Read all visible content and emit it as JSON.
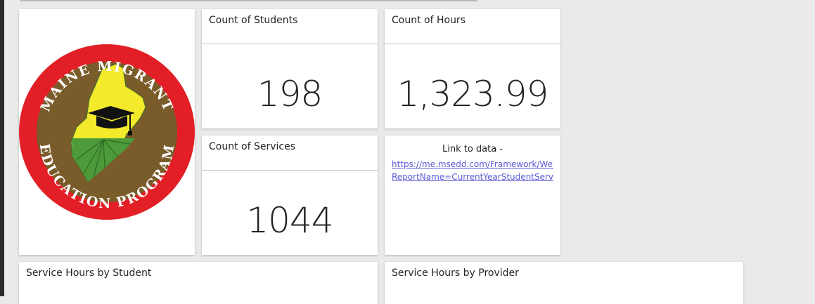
{
  "logo": {
    "top_text": "MAINE MIGRANT",
    "bottom_text": "EDUCATION PROGRAM",
    "colors": {
      "ring": "#e21f26",
      "field": "#7a5c2a",
      "state": "#f2ea2a",
      "crops": "#4c9a3a"
    }
  },
  "tiles": {
    "students": {
      "title": "Count of Students",
      "value": "198"
    },
    "hours": {
      "title": "Count of Hours",
      "value": "1,323.99"
    },
    "services": {
      "title": "Count of Services",
      "value": "1044"
    },
    "link": {
      "caption": "Link to data -",
      "line1": "https://me.msedd.com/Framework/Web",
      "line2": "ReportName=CurrentYearStudentServic"
    },
    "by_student": {
      "title": "Service Hours by Student"
    },
    "by_provider": {
      "title": "Service Hours by Provider"
    }
  }
}
